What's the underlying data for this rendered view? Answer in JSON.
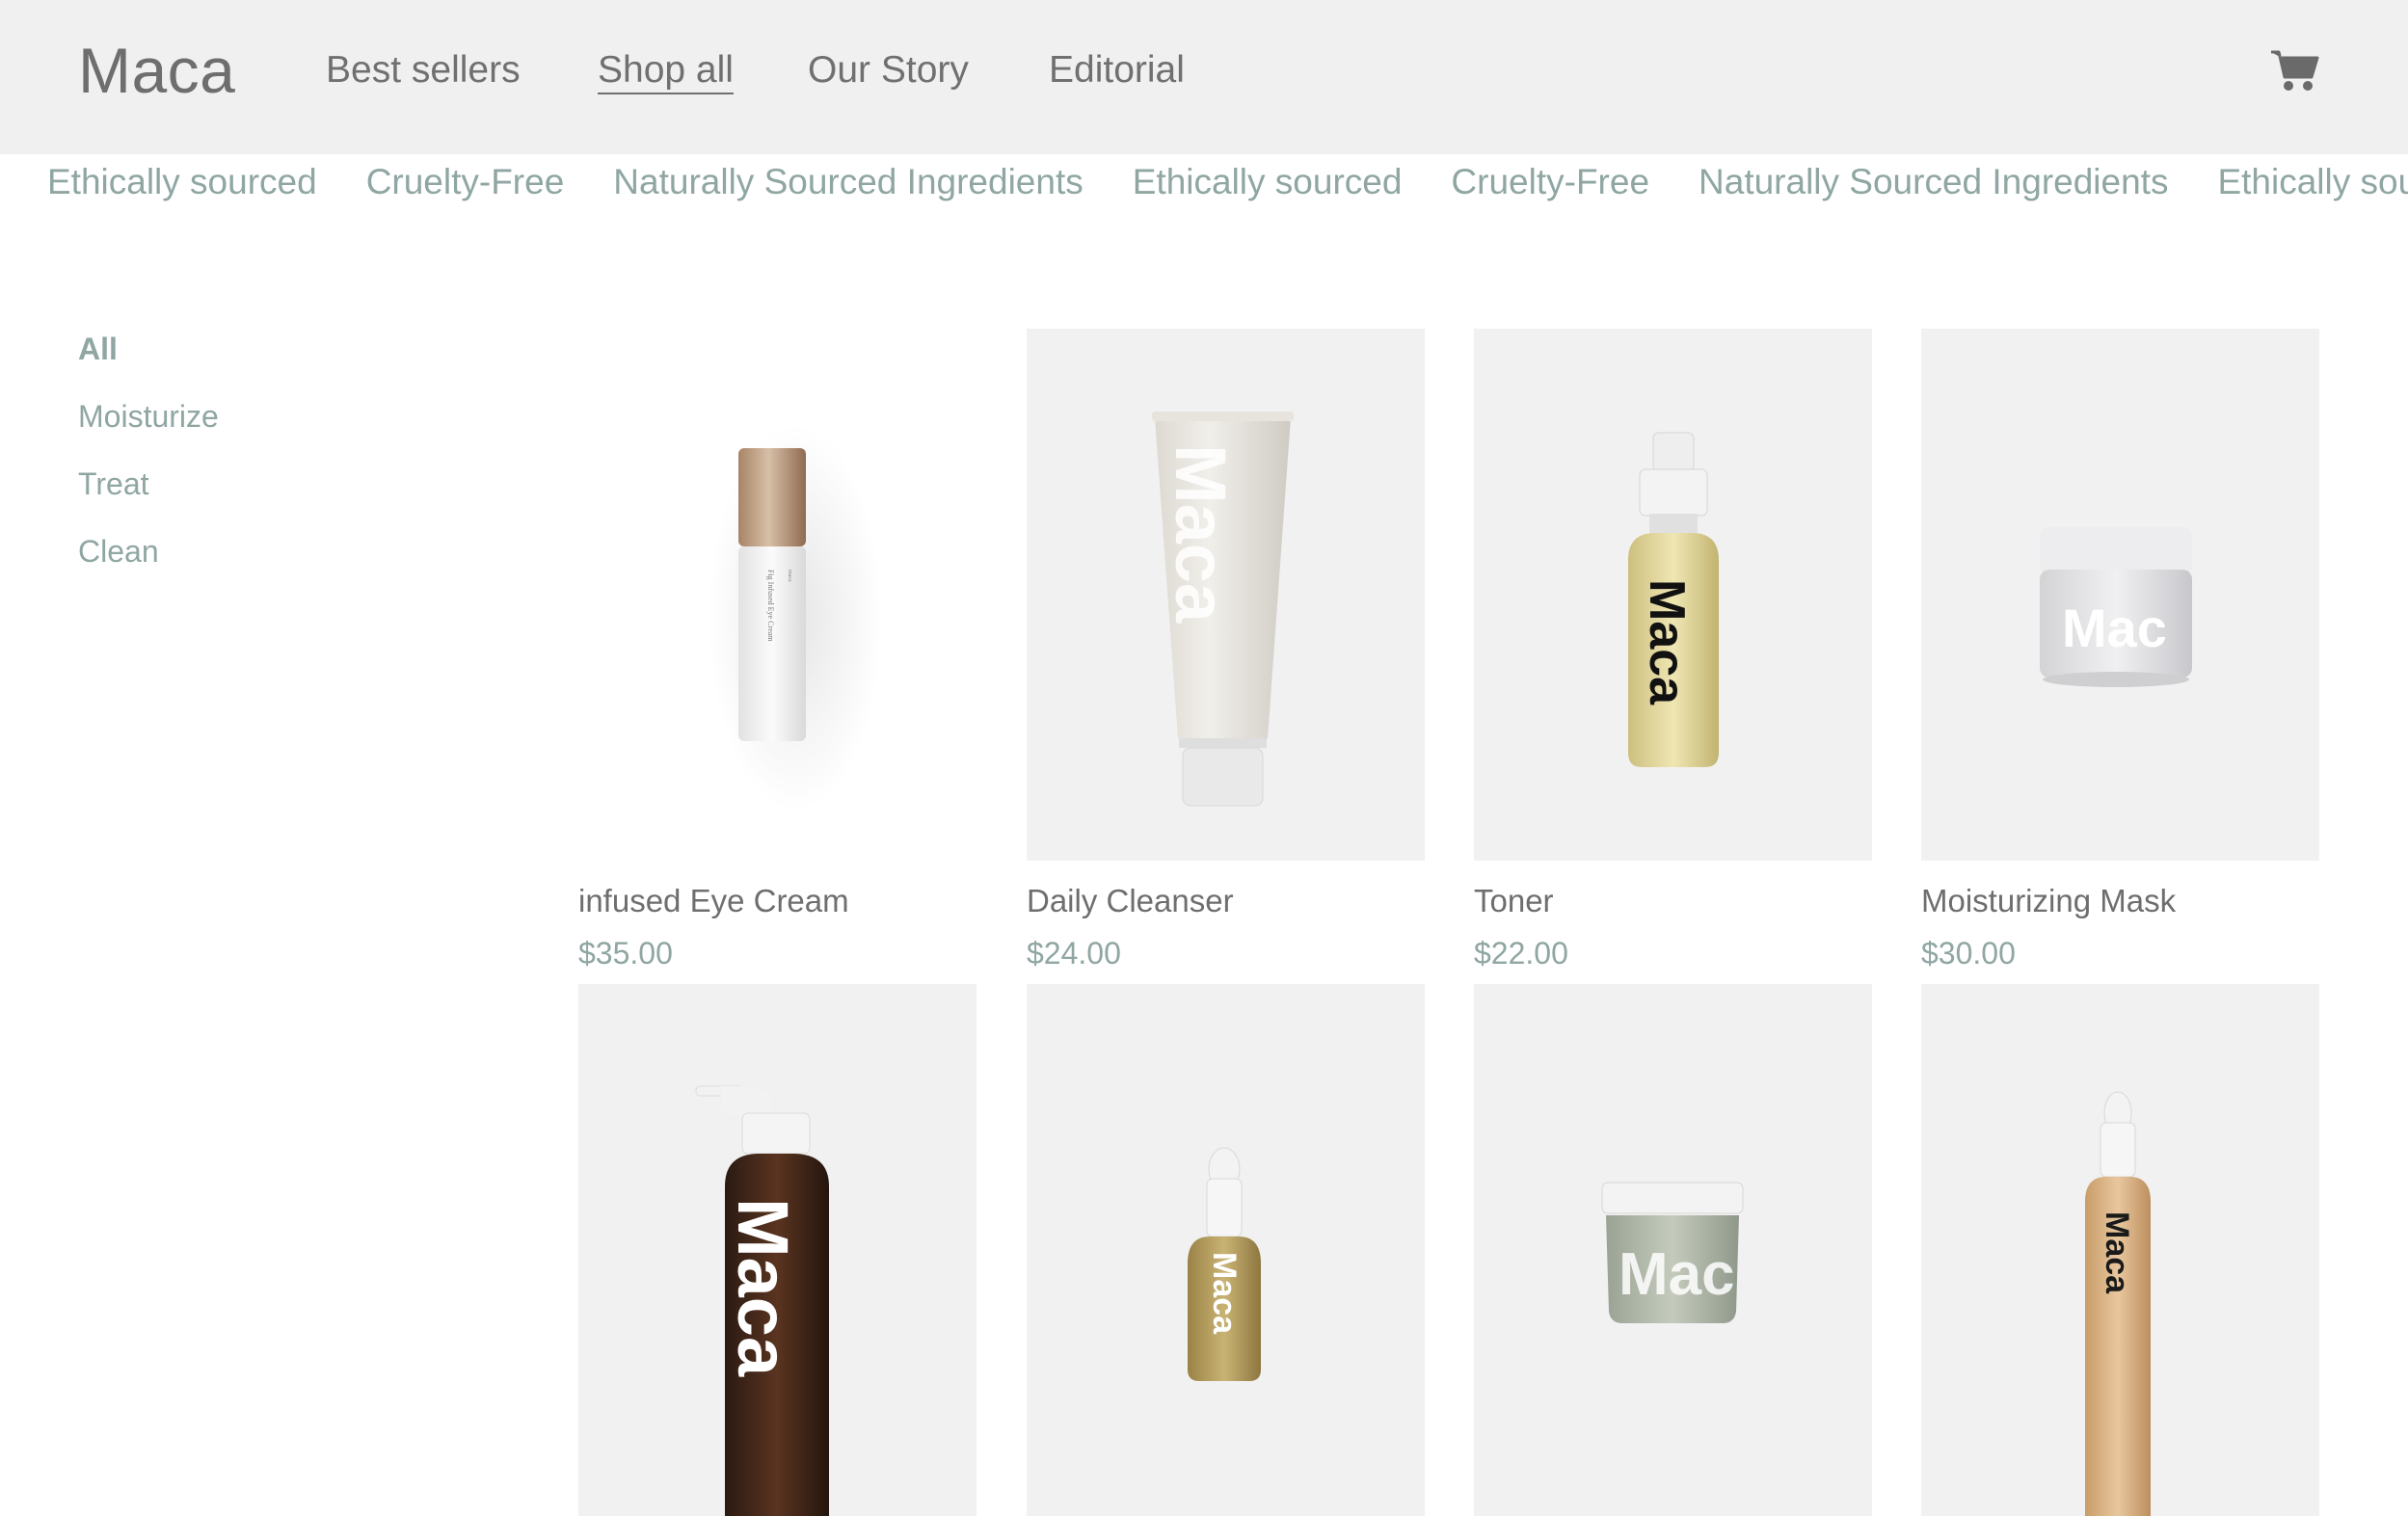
{
  "header": {
    "logo": "Maca",
    "nav": [
      {
        "label": "Best sellers"
      },
      {
        "label": "Shop all",
        "active": true
      },
      {
        "label": "Our Story"
      },
      {
        "label": "Editorial"
      }
    ],
    "cart_icon": "cart-icon"
  },
  "marquee": {
    "items": [
      "Ethically sourced",
      "Cruelty-Free",
      "Naturally Sourced Ingredients",
      "Ethically sourced",
      "Cruelty-Free",
      "Naturally Sourced Ingredients",
      "Ethically sourced"
    ]
  },
  "filters": {
    "items": [
      {
        "label": "All",
        "active": true
      },
      {
        "label": "Moisturize"
      },
      {
        "label": "Treat"
      },
      {
        "label": "Clean"
      }
    ]
  },
  "products": [
    {
      "name": "infused Eye Cream",
      "price": "$35.00",
      "label": "Fig Infused Eye Cream",
      "brand": "maca"
    },
    {
      "name": "Daily Cleanser",
      "price": "$24.00",
      "label": "Maca"
    },
    {
      "name": "Toner",
      "price": "$22.00",
      "label": "Maca"
    },
    {
      "name": "Moisturizing Mask",
      "price": "$30.00",
      "label": "Mac"
    },
    {
      "label": "Maca"
    },
    {
      "label": "Maca"
    },
    {
      "label": "Mac"
    },
    {
      "label": "Maca"
    }
  ],
  "colors": {
    "header_bg": "#f0f0f0",
    "accent_sage": "#8fa6a3",
    "text_gray": "#6e6e6e",
    "tile_bg": "#f1f1f1"
  }
}
